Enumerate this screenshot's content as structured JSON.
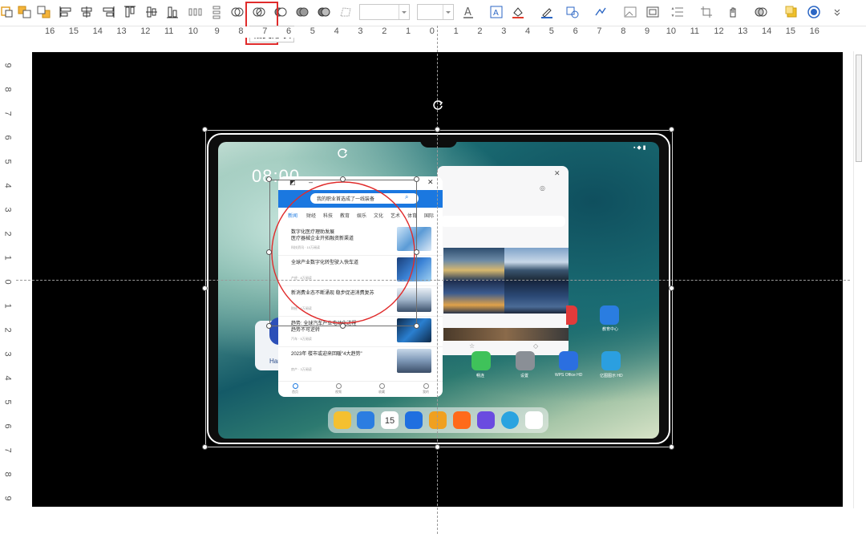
{
  "toolbar": {
    "tooltip": "相交形状"
  },
  "ruler": {
    "horizontal": [
      "16",
      "15",
      "14",
      "13",
      "12",
      "11",
      "10",
      "9",
      "8",
      "7",
      "6",
      "5",
      "4",
      "3",
      "2",
      "1",
      "0",
      "1",
      "2",
      "3",
      "4",
      "5",
      "6",
      "7",
      "8",
      "9",
      "10",
      "11",
      "12",
      "13",
      "14",
      "15",
      "16"
    ],
    "vertical": [
      "9",
      "8",
      "7",
      "6",
      "5",
      "4",
      "3",
      "2",
      "1",
      "0",
      "1",
      "2",
      "3",
      "4",
      "5",
      "6",
      "7",
      "8",
      "9"
    ]
  },
  "tablet": {
    "clock": "08:00",
    "widget_label": "Har",
    "news": {
      "search_text": "我的职业首选成了一线装备",
      "tabs": [
        "新闻",
        "财经",
        "科技",
        "教育",
        "娱乐",
        "文化",
        "艺术",
        "体育",
        "国际"
      ],
      "items": [
        {
          "title": "数字化医疗理助发展\n医疗器械企业开拓融资新渠道",
          "meta": "科技资讯 · 10万阅读"
        },
        {
          "title": "全球产业数字化转型驶入快车道",
          "meta": "产经 · 8万阅读"
        },
        {
          "title": "新消费业态不断涌现 稳步促进消费复苏",
          "meta": "财经 · 6万阅读"
        },
        {
          "title": "趋势: 全球汽车产业电动化进程\n趋势不可逆转",
          "meta": "汽车 · 5万阅读"
        },
        {
          "title": "2023年 楼市或迎来回暖\"4大趋势\"",
          "meta": "房产 · 3万阅读"
        }
      ],
      "nav": [
        "首页",
        "视频",
        "收藏",
        "我的"
      ]
    },
    "home_labels": [
      "教育中心",
      "畅连",
      "设置",
      "WPS Office HD",
      "亿图图示 HD"
    ],
    "colors": {
      "accent": "#1b78e0",
      "selection_circle": "#e02b2b"
    }
  }
}
